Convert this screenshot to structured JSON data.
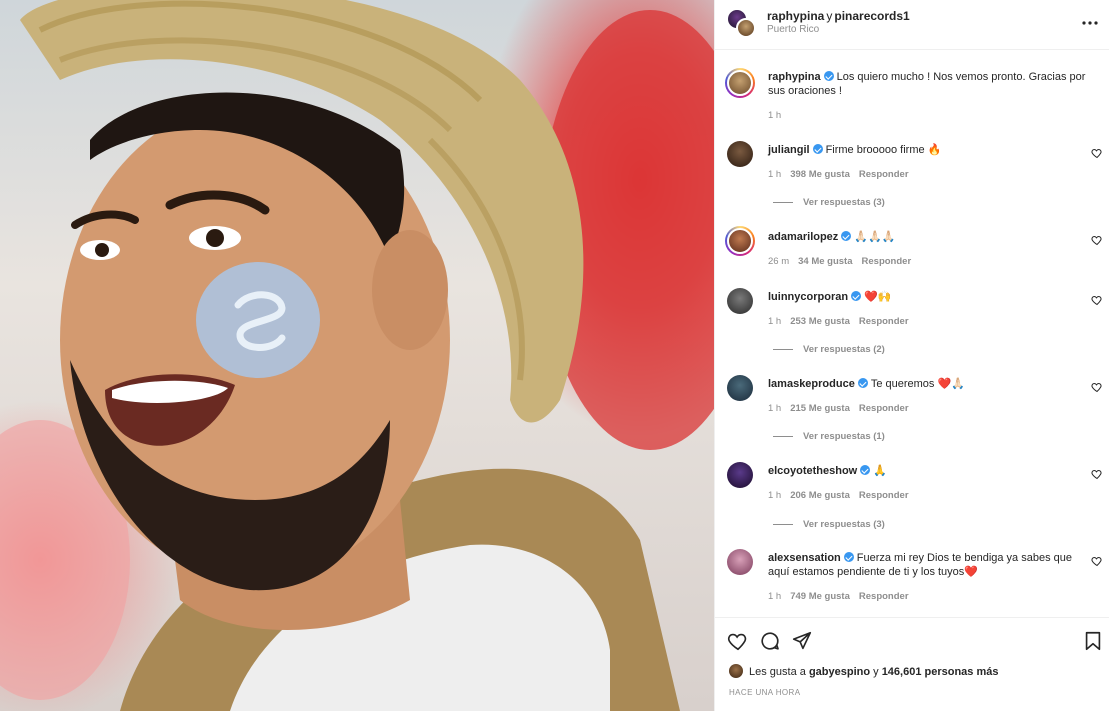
{
  "post": {
    "author": "raphypina",
    "conjunction": "y",
    "collaborator": "pinarecords1",
    "location": "Puerto Rico"
  },
  "caption": {
    "user": "raphypina",
    "text": "Los quiero mucho ! Nos vemos pronto. Gracias por sus oraciones !",
    "time": "1 h"
  },
  "comments": [
    {
      "user": "juliangil",
      "text": "Firme brooooo firme 🔥",
      "time": "1 h",
      "likes": "398 Me gusta",
      "reply": "Responder",
      "replies": "Ver respuestas (3)"
    },
    {
      "user": "adamarilopez",
      "text": "🙏🏻🙏🏻🙏🏻",
      "time": "26 m",
      "likes": "34 Me gusta",
      "reply": "Responder",
      "replies": ""
    },
    {
      "user": "luinnycorporan",
      "text": "❤️🙌",
      "time": "1 h",
      "likes": "253 Me gusta",
      "reply": "Responder",
      "replies": "Ver respuestas (2)"
    },
    {
      "user": "lamaskeproduce",
      "text": "Te queremos ❤️🙏🏻",
      "time": "1 h",
      "likes": "215 Me gusta",
      "reply": "Responder",
      "replies": "Ver respuestas (1)"
    },
    {
      "user": "elcoyotetheshow",
      "text": "🙏",
      "time": "1 h",
      "likes": "206 Me gusta",
      "reply": "Responder",
      "replies": "Ver respuestas (3)"
    },
    {
      "user": "alexsensation",
      "text": "Fuerza mi rey Dios te bendiga ya sabes que aquí estamos pendiente de ti y los tuyos❤️",
      "time": "1 h",
      "likes": "749 Me gusta",
      "reply": "Responder",
      "replies": ""
    }
  ],
  "likes": {
    "prefix": "Les gusta a",
    "first_user": "gabyespino",
    "middle": "y",
    "others": "146,601 personas más"
  },
  "timestamp": "HACE UNA HORA",
  "icons": {
    "more": "more-options-icon",
    "like": "heart-icon",
    "comment": "comment-icon",
    "share": "share-icon",
    "save": "bookmark-icon"
  },
  "colors": {
    "verified": "#3897f0",
    "muted": "#8e8e8e",
    "text": "#262626"
  }
}
